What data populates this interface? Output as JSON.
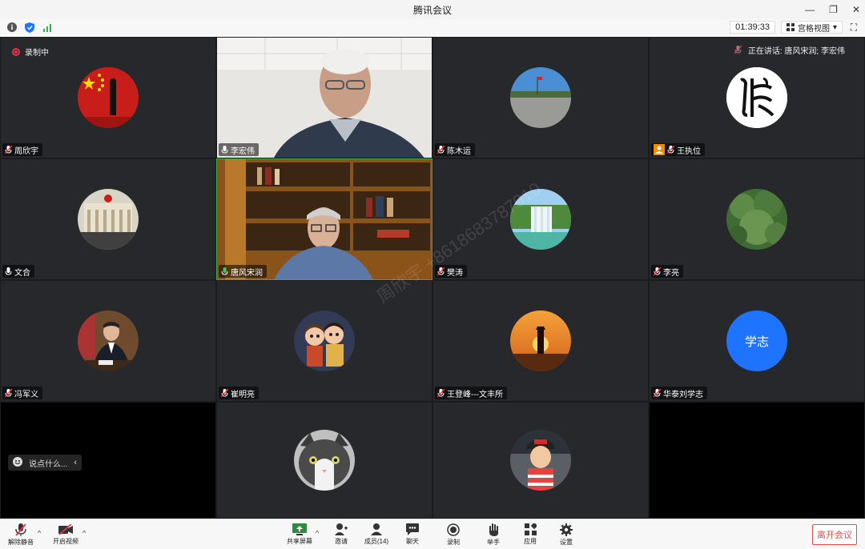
{
  "window": {
    "title": "腾讯会议",
    "controls": [
      "—",
      "❐",
      "✕"
    ]
  },
  "infobar": {
    "timer": "01:39:33",
    "view_mode": "宫格视图",
    "icons": [
      "info-icon",
      "shield-icon",
      "signal-icon"
    ]
  },
  "stage": {
    "recording_label": "录制中",
    "speaking_label": "正在讲话: 唐风宋润; 李宏伟",
    "chat_placeholder": "说点什么...",
    "watermark": "周欣宇 +8618683787910"
  },
  "participants": [
    {
      "name": "周欣宇",
      "kind": "avatar",
      "avatar": "flag-photo",
      "mic": "muted"
    },
    {
      "name": "李宏伟",
      "kind": "video",
      "avatar": "man-office-video",
      "mic": "on"
    },
    {
      "name": "陈木运",
      "kind": "avatar",
      "avatar": "square-photo",
      "mic": "muted"
    },
    {
      "name": "王执位",
      "kind": "avatar",
      "avatar": "seal-logo",
      "mic": "muted",
      "badge": "host"
    },
    {
      "name": "文合",
      "kind": "avatar",
      "avatar": "building-photo",
      "mic": "on"
    },
    {
      "name": "唐风宋润",
      "kind": "video",
      "avatar": "man-bookshelf-video",
      "mic": "speaking"
    },
    {
      "name": "樊涛",
      "kind": "avatar",
      "avatar": "waterfall-photo",
      "mic": "muted"
    },
    {
      "name": "李亮",
      "kind": "avatar",
      "avatar": "tree-photo",
      "mic": "muted"
    },
    {
      "name": "冯军义",
      "kind": "avatar",
      "avatar": "man-desk-photo",
      "mic": "muted"
    },
    {
      "name": "崔明亮",
      "kind": "avatar",
      "avatar": "cartoon-photo",
      "mic": "muted"
    },
    {
      "name": "王登峰---文丰所",
      "kind": "avatar",
      "avatar": "sunset-photo",
      "mic": "muted"
    },
    {
      "name": "华泰刘学志",
      "kind": "avatar",
      "avatar": "text-avatar",
      "avatar_text": "学志",
      "mic": "muted"
    },
    {
      "name": "",
      "kind": "empty"
    },
    {
      "name": "",
      "kind": "avatar",
      "avatar": "cat-photo",
      "mic": "muted"
    },
    {
      "name": "",
      "kind": "avatar",
      "avatar": "child-photo",
      "mic": "muted"
    },
    {
      "name": "",
      "kind": "empty"
    }
  ],
  "toolbar": {
    "unmute": "解除静音",
    "start_video": "开启视频",
    "share": "共享屏幕",
    "invite": "邀请",
    "members": "成员(14)",
    "chat": "聊天",
    "record": "录制",
    "raise_hand": "举手",
    "apps": "应用",
    "settings": "设置",
    "leave": "离开会议"
  },
  "colors": {
    "accent_blue": "#1e74ff",
    "leave_red": "#e94b4b",
    "tile_bg": "#26282b"
  }
}
